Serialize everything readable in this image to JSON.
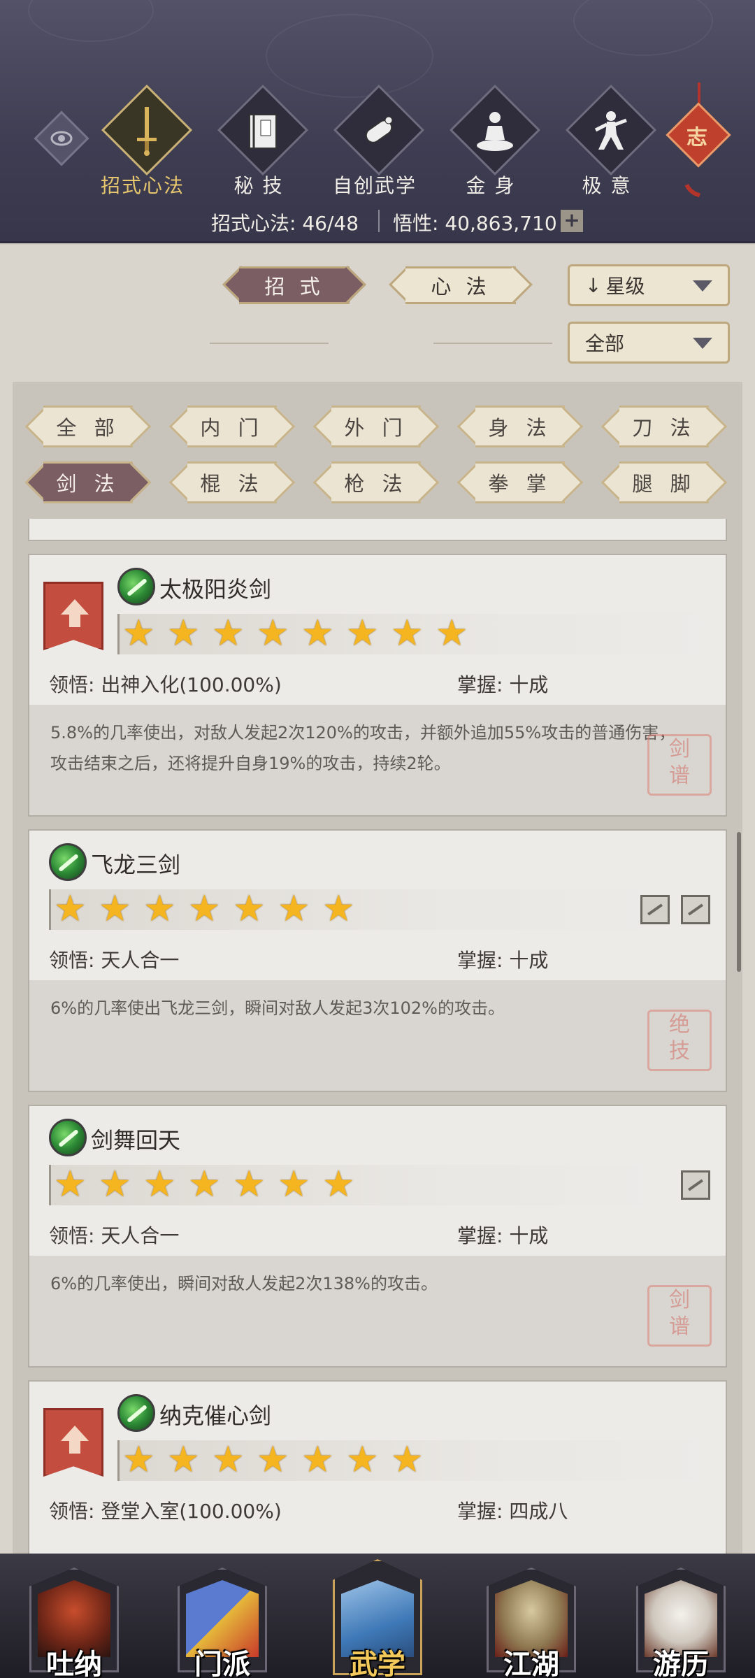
{
  "top_nav": [
    {
      "label": "招式心法",
      "icon": "sword-icon",
      "active": true
    },
    {
      "label": "秘 技",
      "icon": "book-icon",
      "active": false
    },
    {
      "label": "自创武学",
      "icon": "scroll-icon",
      "active": false
    },
    {
      "label": "金 身",
      "icon": "meditation-icon",
      "active": false
    },
    {
      "label": "极 意",
      "icon": "martial-stance-icon",
      "active": false
    }
  ],
  "zhi_badge": "志",
  "stats": {
    "skills_label": "招式心法: 46/48",
    "insight_label": "悟性: 40,863,710",
    "plus": "+"
  },
  "main_tabs": {
    "moves": "招 式",
    "mind": "心 法"
  },
  "sort_select": {
    "value": "星级",
    "arrow": "↓"
  },
  "filter_select": {
    "value": "全部"
  },
  "categories": [
    {
      "label": "全 部",
      "active": false
    },
    {
      "label": "内 门",
      "active": false
    },
    {
      "label": "外 门",
      "active": false
    },
    {
      "label": "身 法",
      "active": false
    },
    {
      "label": "刀 法",
      "active": false
    },
    {
      "label": "剑 法",
      "active": true
    },
    {
      "label": "棍 法",
      "active": false
    },
    {
      "label": "枪 法",
      "active": false
    },
    {
      "label": "拳 掌",
      "active": false
    },
    {
      "label": "腿 脚",
      "active": false
    }
  ],
  "skills": [
    {
      "name": "太极阳炎剑",
      "stars": 8,
      "upgrade": true,
      "insight": "领悟: 出神入化(100.00%)",
      "mastery": "掌握: 十成",
      "desc": "5.8%的几率使出，对敌人发起2次120%的攻击，并额外追加55%攻击的普通伤害，攻击结束之后，还将提升自身19%的攻击，持续2轮。",
      "seal": "剑谱"
    },
    {
      "name": "飞龙三剑",
      "stars": 7,
      "upgrade": false,
      "insight": "领悟: 天人合一",
      "mastery": "掌握: 十成",
      "desc": "6%的几率使出飞龙三剑，瞬间对敌人发起3次102%的攻击。",
      "seal": "绝技"
    },
    {
      "name": "剑舞回天",
      "stars": 7,
      "upgrade": false,
      "insight": "领悟: 天人合一",
      "mastery": "掌握: 十成",
      "desc": "6%的几率使出，瞬间对敌人发起2次138%的攻击。",
      "seal": "剑谱"
    },
    {
      "name": "纳克催心剑",
      "stars": 7,
      "upgrade": true,
      "insight": "领悟: 登堂入室(100.00%)",
      "mastery": "掌握: 四成八",
      "desc": "",
      "seal": ""
    }
  ],
  "bottom_nav": [
    {
      "label": "吐纳",
      "active": false
    },
    {
      "label": "门派",
      "active": false
    },
    {
      "label": "武学",
      "active": true
    },
    {
      "label": "江湖",
      "active": false
    },
    {
      "label": "游历",
      "active": false
    }
  ]
}
